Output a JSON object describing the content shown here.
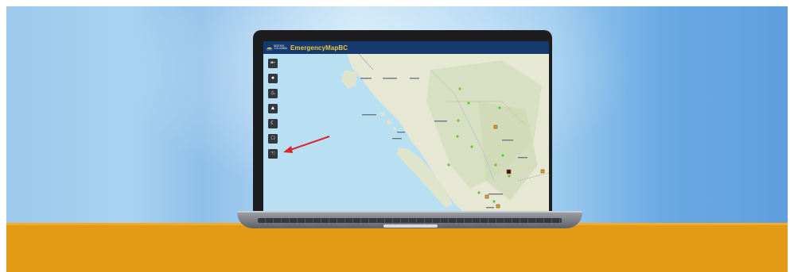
{
  "app": {
    "logo_text": "BRITISH COLUMBIA",
    "title": "EmergencyMapBC"
  },
  "toolbar": {
    "tools": [
      {
        "icon": "collapse-panel-icon",
        "glyph": "⇤"
      },
      {
        "icon": "person-icon",
        "glyph": "●"
      },
      {
        "icon": "fire-icon",
        "glyph": "♨"
      },
      {
        "icon": "alert-icon",
        "glyph": "▲"
      },
      {
        "icon": "weather-icon",
        "glyph": "☾"
      },
      {
        "icon": "area-select-icon",
        "glyph": "□"
      },
      {
        "icon": "hand-pointer-icon",
        "glyph": "☜"
      }
    ]
  },
  "map": {
    "labels": [
      "Haida Gwaii",
      "Prince Rupert",
      "Terrace",
      "Smithers",
      "Prince George",
      "Williams Lake",
      "Kamloops",
      "Vancouver",
      "Victoria",
      "Queen Charlotte Sound"
    ]
  },
  "colors": {
    "header": "#173a6e",
    "title": "#f3c63a",
    "annotation": "#d9262c"
  }
}
